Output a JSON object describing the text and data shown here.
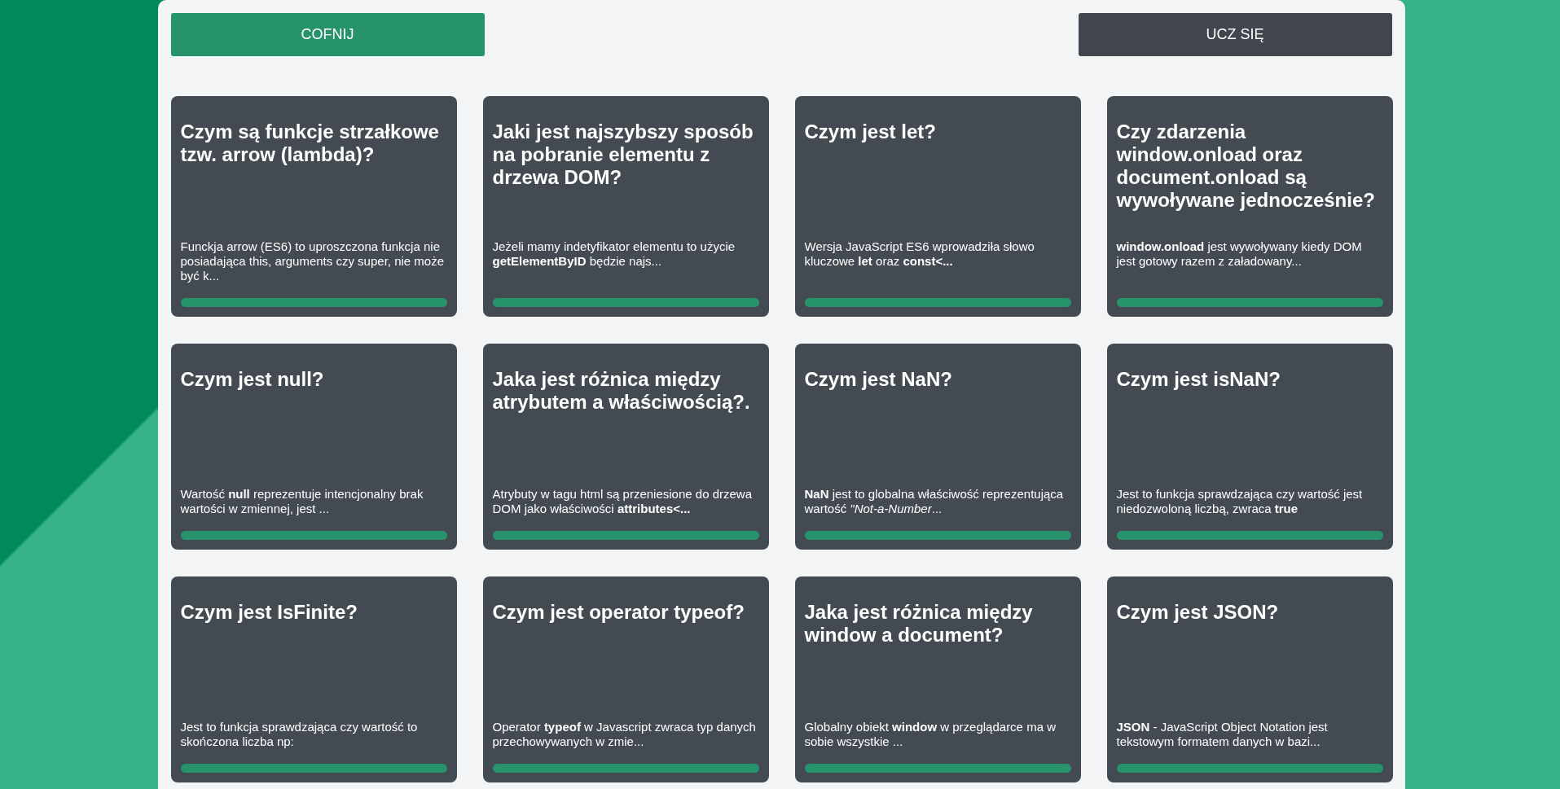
{
  "buttons": [
    {
      "label": "COFNIJ",
      "kind": "primary"
    },
    {
      "label": "UCZ SIĘ",
      "kind": "dark"
    }
  ],
  "cards": [
    {
      "title": "Czym są funkcje strzałkowe tzw. arrow (lambda)?",
      "description": "Funckja arrow (ES6) to uproszczona funkcja nie posiadająca this, arguments czy super, nie może być k..."
    },
    {
      "title": "Jaki jest najszybszy sposób na pobranie elementu z drzewa DOM?",
      "description": "Jeżeli mamy indetyfikator elementu to użycie **getElementByID** będzie najs..."
    },
    {
      "title": "Czym jest let?",
      "description": "Wersja JavaScript ES6 wprowadziła słowo kluczowe **let** oraz **const<...**"
    },
    {
      "title": "Czy zdarzenia window.onload oraz document.onload są wywoływane jednocześnie?",
      "description": "**window.onload** jest wywoływany kiedy DOM jest gotowy razem z załadowany..."
    },
    {
      "title": "Czym jest null?",
      "description": "Wartość **null** reprezentuje intencjonalny brak wartości w zmiennej, jest ..."
    },
    {
      "title": "Jaka jest różnica między atrybutem a właściwością?.",
      "description": "Atrybuty w tagu html są przeniesione do drzewa DOM jako właściwości **attributes<...**"
    },
    {
      "title": "Czym jest NaN?",
      "description": "**NaN** jest to globalna właściwość reprezentująca wartość *\"Not-a-Number*..."
    },
    {
      "title": "Czym jest isNaN?",
      "description": "Jest to funkcja sprawdzająca czy wartość jest niedozwoloną liczbą, zwraca **true**"
    },
    {
      "title": "Czym jest IsFinite?",
      "description": "Jest to funkcja sprawdzająca czy wartość to skończona liczba np:"
    },
    {
      "title": "Czym jest operator typeof?",
      "description": "Operator **typeof** w Javascript zwraca typ danych przechowywanych w zmie..."
    },
    {
      "title": "Jaka jest różnica między window a document?",
      "description": "Globalny obiekt **window** w przeglądarce ma w sobie wszystkie ..."
    },
    {
      "title": "Czym jest JSON?",
      "description": "**JSON** - JavaScript Object Notation jest tekstowym formatem danych w bazi..."
    }
  ]
}
